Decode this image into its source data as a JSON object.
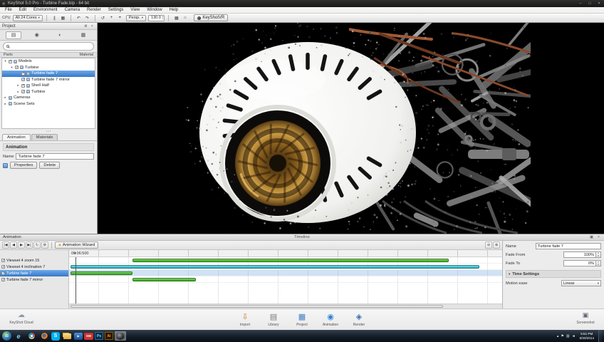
{
  "colors": {
    "selection_blue": "#3d85d8",
    "clip_green": "#46b52a",
    "clip_teal": "#38bccb",
    "viewport_bg": "#000000"
  },
  "titlebar": {
    "title": "KeyShot 5.0 Pro - Turbine Fade.bip - 64 bit",
    "minimize": "–",
    "maximize": "□",
    "close": "×"
  },
  "menubar": {
    "items": [
      "File",
      "Edit",
      "Environment",
      "Camera",
      "Render",
      "Settings",
      "View",
      "Window",
      "Help"
    ]
  },
  "toolbar": {
    "cpu_label": "CPU",
    "cores_value": "All 24 Cores",
    "icons_render": [
      {
        "name": "pause-render-icon",
        "glyph": "∥"
      },
      {
        "name": "region-render-icon",
        "glyph": "▦"
      }
    ],
    "icons_history": [
      {
        "name": "undo-icon",
        "glyph": "↶"
      },
      {
        "name": "redo-icon",
        "glyph": "↷"
      }
    ],
    "icons_camera": [
      {
        "name": "tumble-icon",
        "glyph": "↺"
      },
      {
        "name": "pan-icon",
        "glyph": "+"
      },
      {
        "name": "dolly-icon",
        "glyph": "⌖"
      }
    ],
    "camera_value": "Persp.",
    "focal_value": "130.0",
    "icons_view": [
      {
        "name": "grid-icon",
        "glyph": "▦"
      },
      {
        "name": "home-view-icon",
        "glyph": "⌂"
      }
    ],
    "vr_label": "KeyShotVR"
  },
  "project": {
    "title": "Project",
    "header_icons": [
      {
        "name": "panel-gear-icon",
        "glyph": "⚙"
      },
      {
        "name": "panel-close-icon",
        "glyph": "×"
      }
    ],
    "tab_icons": [
      {
        "name": "scene-tab-icon",
        "glyph": "▤"
      },
      {
        "name": "material-tab-icon",
        "glyph": "◉"
      },
      {
        "name": "environment-tab-icon",
        "glyph": "◐"
      },
      {
        "name": "settings-tab-icon",
        "glyph": "▦"
      }
    ],
    "search_placeholder": "",
    "parts_header": "Parts",
    "material_header": "Material",
    "tree": [
      {
        "label": "Models",
        "level": 0,
        "expander": "▾",
        "checked": true,
        "selected": false
      },
      {
        "label": "Turbine",
        "level": 1,
        "expander": "▾",
        "checked": true,
        "selected": false
      },
      {
        "label": "Turbine fade 7",
        "level": 2,
        "expander": "",
        "checked": true,
        "selected": true
      },
      {
        "label": "Turbine fade 7 mirror",
        "level": 2,
        "expander": "",
        "checked": true,
        "selected": false
      },
      {
        "label": "Shell Half",
        "level": 2,
        "expander": "▸",
        "checked": true,
        "selected": false
      },
      {
        "label": "Turbine",
        "level": 2,
        "expander": "▸",
        "checked": true,
        "selected": false
      },
      {
        "label": "Cameras",
        "level": 0,
        "expander": "▸",
        "checked": null,
        "selected": false
      },
      {
        "label": "Scene Sets",
        "level": 0,
        "expander": "▸",
        "checked": null,
        "selected": false
      }
    ],
    "bottom_tabs": [
      {
        "label": "Animation",
        "active": true
      },
      {
        "label": "Materials",
        "active": false
      }
    ],
    "animation": {
      "header": "Animation",
      "name_label": "Name",
      "name_value": "Turbine fade 7",
      "properties_button": "Properties",
      "delete_button": "Delete"
    }
  },
  "timeline": {
    "section_title": "Animation",
    "panel_title": "Timeline",
    "titlebar_icons": [
      {
        "name": "undock-icon",
        "glyph": "▣"
      },
      {
        "name": "close-timeline-icon",
        "glyph": "×"
      }
    ],
    "transport_icons": [
      {
        "name": "go-to-start-icon",
        "glyph": "|◀"
      },
      {
        "name": "step-back-icon",
        "glyph": "◀"
      },
      {
        "name": "play-icon",
        "glyph": "▶"
      },
      {
        "name": "go-to-end-icon",
        "glyph": "▶|"
      },
      {
        "name": "loop-icon",
        "glyph": "↻"
      },
      {
        "name": "timeline-settings-icon",
        "glyph": "⚙"
      }
    ],
    "wizard_button": "Animation Wizard",
    "zoom_icons": [
      {
        "name": "zoom-out-icon",
        "glyph": "⊖"
      },
      {
        "name": "zoom-in-icon",
        "glyph": "⊕"
      }
    ],
    "time_readout": "00:06:500",
    "tracks": [
      {
        "name": "Viewset 4 zoom 15",
        "checked": true,
        "selected": false,
        "bar": {
          "start": 14.6,
          "width": 73,
          "color": "#46b52a"
        }
      },
      {
        "name": "Viewset 4 inclination 7",
        "checked": true,
        "selected": false,
        "bar": {
          "start": 0.4,
          "width": 94.3,
          "color": "#38bccb"
        }
      },
      {
        "name": "Turbine fade 7",
        "checked": true,
        "selected": true,
        "bar": {
          "start": 0.4,
          "width": 14.2,
          "color": "#46b52a"
        }
      },
      {
        "name": "Turbine fade 7 mirror",
        "checked": true,
        "selected": false,
        "bar": {
          "start": 14.6,
          "width": 14.6,
          "color": "#46b52a"
        }
      }
    ],
    "properties": {
      "name_label": "Name",
      "name_value": "Turbine fade 7",
      "fade_from_label": "Fade From",
      "fade_from_value": "100%",
      "fade_to_label": "Fade To",
      "fade_to_value": "0%",
      "time_settings_label": "Time Settings",
      "motion_ease_label": "Motion ease",
      "motion_ease_value": "Linear"
    }
  },
  "dock": {
    "cloud_label": "KeyShot Cloud",
    "items": [
      {
        "name": "import",
        "label": "Import",
        "glyph": "⇩"
      },
      {
        "name": "library",
        "label": "Library",
        "glyph": "▤"
      },
      {
        "name": "project",
        "label": "Project",
        "glyph": "▦"
      },
      {
        "name": "animation",
        "label": "Animation",
        "glyph": "◉"
      },
      {
        "name": "render",
        "label": "Render",
        "glyph": "◈"
      }
    ],
    "screenshot_label": "Screenshot"
  },
  "taskbar": {
    "icons": [
      {
        "name": "start-button",
        "kind": "start",
        "glyph": "⊞",
        "active": false
      },
      {
        "name": "internet-explorer",
        "kind": "ie",
        "glyph": "e",
        "active": false
      },
      {
        "name": "chrome",
        "kind": "chrome",
        "glyph": "",
        "active": false
      },
      {
        "name": "firefox",
        "kind": "firefox",
        "glyph": "",
        "active": false
      },
      {
        "name": "skype",
        "kind": "skype",
        "glyph": "S",
        "active": false
      },
      {
        "name": "explorer-folder",
        "kind": "folder",
        "glyph": "",
        "active": false
      },
      {
        "name": "media-player",
        "kind": "wmp",
        "glyph": "▶",
        "active": false
      },
      {
        "name": "solidworks",
        "kind": "sw",
        "glyph": "SW",
        "active": false
      },
      {
        "name": "photoshop",
        "kind": "ps",
        "glyph": "Ps",
        "active": false
      },
      {
        "name": "illustrator",
        "kind": "ai",
        "glyph": "Ai",
        "active": false
      },
      {
        "name": "keyshot",
        "kind": "keyshot",
        "glyph": "",
        "active": true
      }
    ],
    "tray_icons": [
      {
        "name": "tray-expand-icon",
        "glyph": "▴"
      },
      {
        "name": "tray-action-icon",
        "glyph": "⚑"
      },
      {
        "name": "tray-network-icon",
        "glyph": "▥"
      },
      {
        "name": "tray-volume-icon",
        "glyph": "◄"
      }
    ],
    "clock_time": "5:51 PM",
    "clock_date": "5/30/2014"
  }
}
